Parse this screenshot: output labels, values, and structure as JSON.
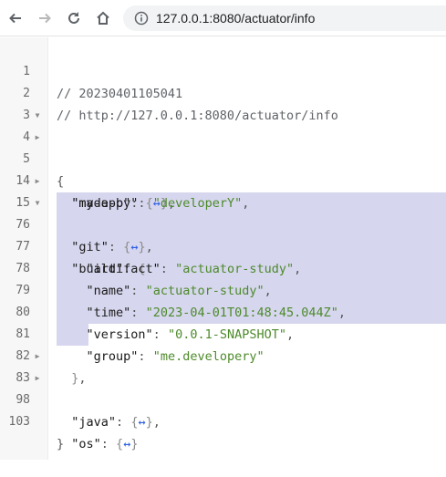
{
  "browser": {
    "url": "127.0.0.1:8080/actuator/info"
  },
  "gutter": {
    "line_numbers": [
      "1",
      "2",
      "3",
      "4",
      "5",
      "14",
      "15",
      "76",
      "77",
      "78",
      "79",
      "80",
      "81",
      "82",
      "83",
      "98",
      "103"
    ]
  },
  "code": {
    "comment_timestamp": "// 20230401105041",
    "comment_url": "// http://127.0.0.1:8080/actuator/info",
    "open_brace": "{",
    "close_brace": "}",
    "entries": {
      "my_app_key": "\"my-app\"",
      "made_by_key": "\"made-by\"",
      "made_by_value": "\"developerY\"",
      "git_key": "\"git\"",
      "build_key": "\"build\"",
      "artifact_key": "\"artifact\"",
      "artifact_value": "\"actuator-study\"",
      "name_key": "\"name\"",
      "name_value": "\"actuator-study\"",
      "time_key": "\"time\"",
      "time_value": "\"2023-04-01T01:48:45.044Z\"",
      "version_key": "\"version\"",
      "version_value": "\"0.0.1-SNAPSHOT\"",
      "group_key": "\"group\"",
      "group_value": "\"me.developery\"",
      "java_key": "\"java\"",
      "os_key": "\"os\""
    },
    "collapsed_marker": "↔"
  },
  "colors": {
    "selection": "#d6d6ee",
    "string": "#4d8a2a",
    "collapsed_marker": "#2f5fe0"
  }
}
